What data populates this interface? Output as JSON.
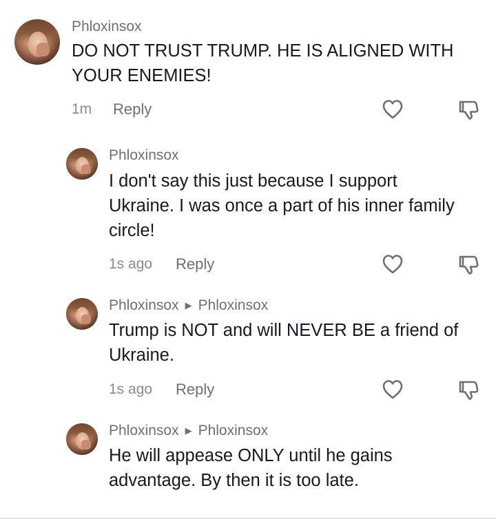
{
  "comments": [
    {
      "username": "Phloxinsox",
      "reply_to": "",
      "text": "DO NOT TRUST TRUMP. HE IS ALIGNED WITH YOUR ENEMIES!",
      "time": "1m",
      "reply_label": "Reply"
    },
    {
      "username": "Phloxinsox",
      "reply_to": "",
      "text": "I don't say this just because I support Ukraine. I was once a part of his inner family circle!",
      "time": "1s ago",
      "reply_label": "Reply"
    },
    {
      "username": "Phloxinsox",
      "reply_to": "Phloxinsox",
      "text": "Trump is NOT and will NEVER BE a friend of Ukraine.",
      "time": "1s ago",
      "reply_label": "Reply"
    },
    {
      "username": "Phloxinsox",
      "reply_to": "Phloxinsox",
      "text": "He will appease ONLY until he gains advantage. By then it is too late.",
      "time": "",
      "reply_label": ""
    }
  ],
  "icons": {
    "like": "heart-outline-icon",
    "dislike": "thumbs-down-icon",
    "reply_arrow": "triangle-right-icon"
  },
  "colors": {
    "text": "#161823",
    "secondary": "#6e6f74",
    "meta": "#8a8b91"
  }
}
